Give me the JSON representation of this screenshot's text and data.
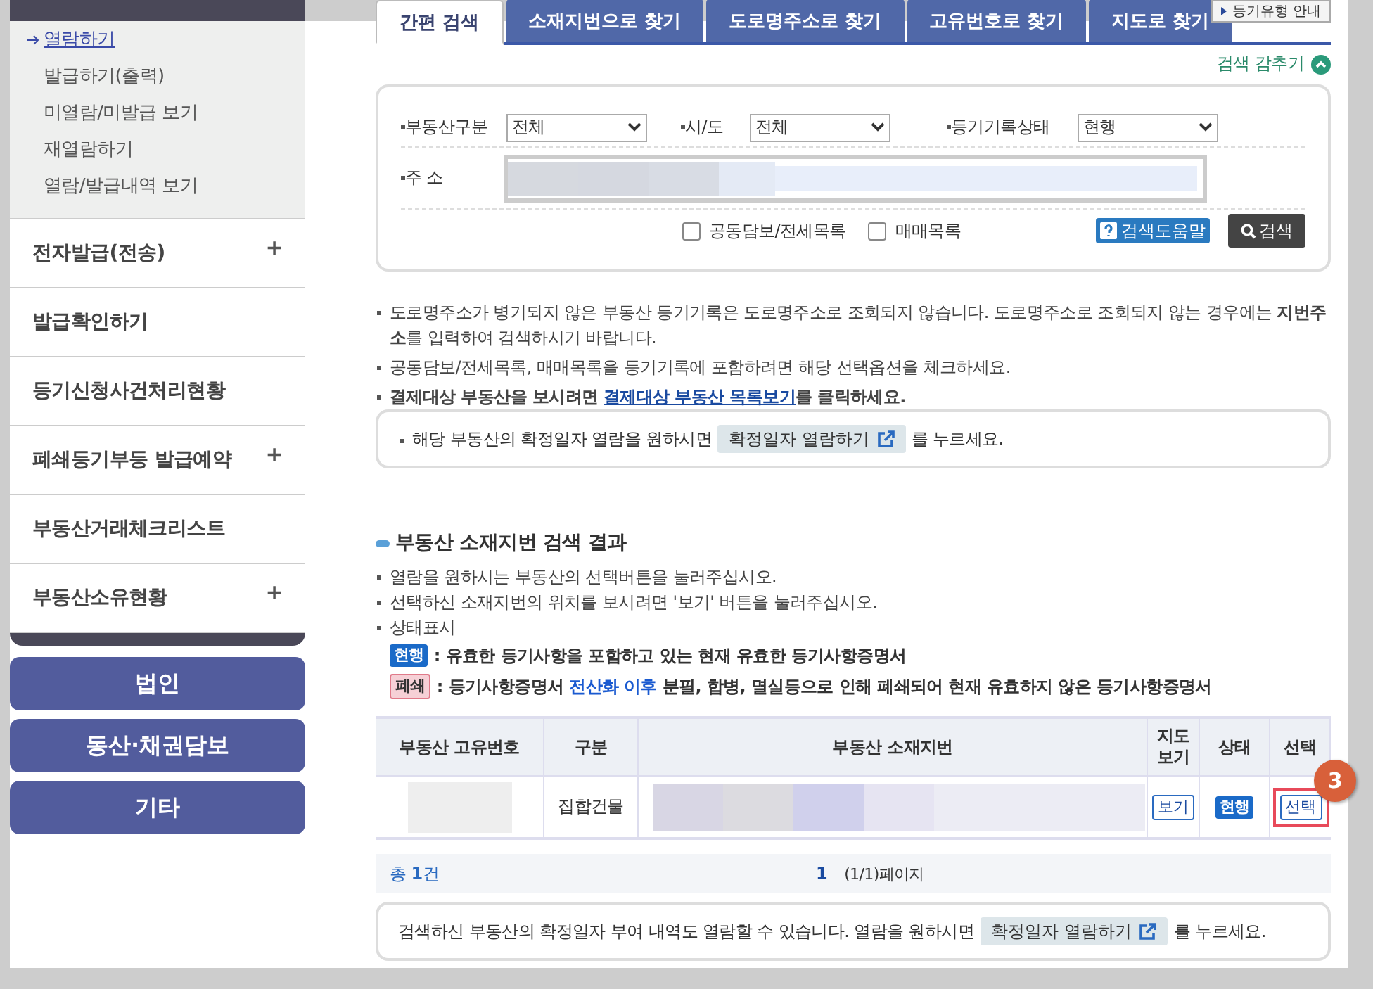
{
  "sidebar": {
    "submenu": [
      {
        "label": "열람하기",
        "selected": true
      },
      {
        "label": "발급하기(출력)",
        "selected": false
      },
      {
        "label": "미열람/미발급 보기",
        "selected": false
      },
      {
        "label": "재열람하기",
        "selected": false
      },
      {
        "label": "열람/발급내역 보기",
        "selected": false
      }
    ],
    "items": [
      {
        "label": "전자발급(전송)",
        "expandable": true
      },
      {
        "label": "발급확인하기",
        "expandable": false
      },
      {
        "label": "등기신청사건처리현황",
        "expandable": false
      },
      {
        "label": "폐쇄등기부등 발급예약",
        "expandable": true
      },
      {
        "label": "부동산거래체크리스트",
        "expandable": false
      },
      {
        "label": "부동산소유현황",
        "expandable": true
      }
    ],
    "expand_mark": "+",
    "buttons": [
      "법인",
      "동산·채권담보",
      "기타"
    ]
  },
  "tabs": [
    {
      "label": "간편 검색",
      "selected": true
    },
    {
      "label": "소재지번으로 찾기",
      "selected": false
    },
    {
      "label": "도로명주소로 찾기",
      "selected": false
    },
    {
      "label": "고유번호로 찾기",
      "selected": false
    },
    {
      "label": "지도로 찾기",
      "selected": false
    }
  ],
  "guide_button": "등기유형 안내",
  "hide_search": "검색 감추기",
  "search_form": {
    "selects": [
      {
        "label": "부동산구분",
        "value": "전체"
      },
      {
        "label": "시/도",
        "value": "전체"
      },
      {
        "label": "등기기록상태",
        "value": "현행"
      }
    ],
    "address_label": "주 소",
    "checkboxes": [
      {
        "label": "공동담보/전세목록",
        "checked": false
      },
      {
        "label": "매매목록",
        "checked": false
      }
    ],
    "help_button": "검색도움말",
    "search_button": "검색"
  },
  "notices": [
    "도로명주소가 병기되지 않은 부동산 등기기록은 도로명주소로 조회되지 않습니다. 도로명주소로 조회되지 않는 경우에는 **지번주소**를 입력하여 검색하시기 바랍니다.",
    "공동담보/전세목록, 매매목록을 등기기록에 포함하려면 해당 선택옵션을 체크하세요."
  ],
  "payment_notice": {
    "before": "결제대상 부동산을 보시려면 ",
    "link": "결제대상 부동산 목록보기",
    "after": "를 클릭하세요."
  },
  "date_notice": {
    "before": "해당 부동산의 확정일자 열람을 원하시면",
    "button": "확정일자 열람하기",
    "after": "를 누르세요."
  },
  "results": {
    "title": "부동산 소재지번 검색 결과",
    "notes": [
      "열람을 원하시는 부동산의 선택버튼을 눌러주십시오.",
      "선택하신 소재지번의 위치를 보시려면 '보기' 버튼을 눌러주십시오.",
      "상태표시"
    ],
    "statuses": [
      {
        "kind": "current",
        "badge": "현행",
        "before": ": 유효한 등기사항을 포함하고 있는 현재 유효한 등기사항증명서"
      },
      {
        "kind": "closed",
        "badge": "폐쇄",
        "before": ": 등기사항증명서 ",
        "highlight": "전산화 이후",
        "after": " 분필, 합병, 멸실등으로 인해 폐쇄되어 현재 유효하지 않은 등기사항증명서"
      }
    ]
  },
  "table": {
    "columns": [
      "부동산 고유번호",
      "구분",
      "부동산 소재지번",
      "지도 보기",
      "상태",
      "선택"
    ],
    "rows": [
      {
        "type": "집합건물",
        "map_button": "보기",
        "status": "현행",
        "select_button": "선택",
        "highlighted": true
      }
    ]
  },
  "pagination": {
    "total": "총 **1**건",
    "page": "1",
    "pages": "(1/1)페이지"
  },
  "bottom_notice": {
    "before": "검색하신 부동산의 확정일자 부여 내역도 열람할 수 있습니다. 열람을 원하시면",
    "button": "확정일자 열람하기",
    "after": "를 누르세요."
  },
  "step_marker": "3"
}
